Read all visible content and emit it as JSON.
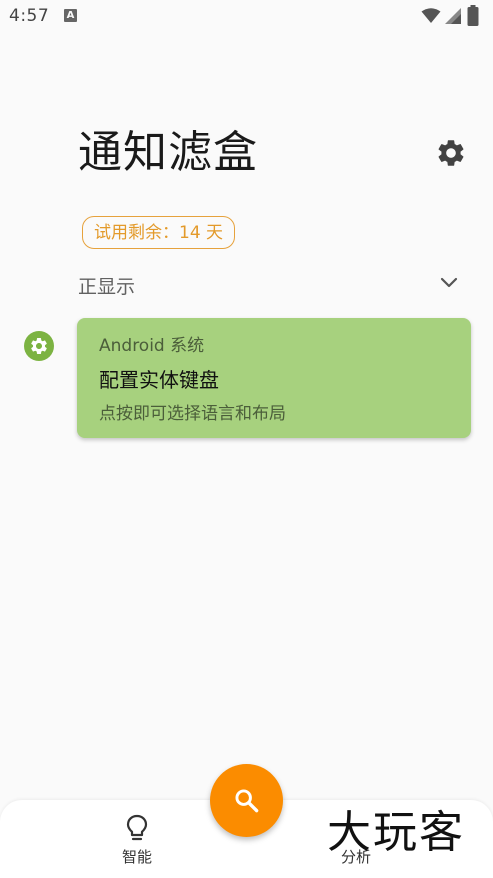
{
  "status_bar": {
    "time": "4:57",
    "notification_icon_letter": "A",
    "icons": [
      "wifi-icon",
      "signal-icon",
      "battery-icon"
    ]
  },
  "header": {
    "title": "通知滤盒",
    "settings_icon": "gear-icon"
  },
  "trial": {
    "label": "试用剩余：14 天"
  },
  "section": {
    "label": "正显示",
    "toggle_icon": "chevron-down-icon"
  },
  "notifications": [
    {
      "app_name": "Android 系统",
      "title": "配置实体键盘",
      "text": "点按即可选择语言和布局",
      "icon": "gear-icon",
      "card_color": "#a7d17e",
      "icon_color": "#7cb342"
    }
  ],
  "bottom_nav": {
    "smart_label": "智能",
    "smart_icon": "bulb-icon",
    "analysis_label": "分析",
    "fab_icon": "search-icon",
    "fab_color": "#fb8c00"
  },
  "watermark": {
    "text": "大玩客"
  },
  "colors": {
    "background": "#fafafa",
    "trial_accent": "#e39a2a"
  }
}
